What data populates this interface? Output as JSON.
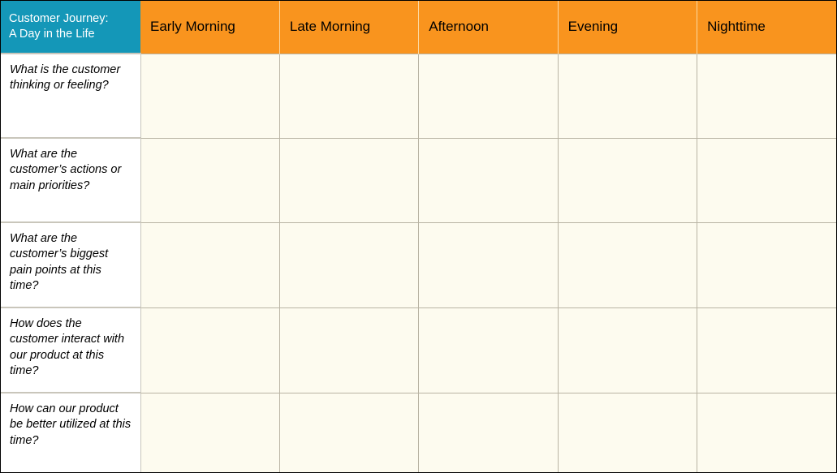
{
  "board": {
    "title_line1": "Customer Journey:",
    "title_line2": "A Day in the Life",
    "title_full": "Customer Journey: A Day in the Life",
    "colors": {
      "title_cell_background": "#1497b8",
      "title_cell_text": "#ffffff",
      "period_header_background": "#f9941e",
      "period_header_text": "#000000",
      "question_cell_background": "#ffffff",
      "entry_cell_background": "#fdfbef",
      "gridline": "#b9b4a4",
      "outer_border": "#000000"
    }
  },
  "columns": [
    {
      "id": "col-question",
      "label": "Customer Journey: A Day in the Life"
    },
    {
      "id": "col-early-morning",
      "label": "Early Morning"
    },
    {
      "id": "col-late-morning",
      "label": "Late Morning"
    },
    {
      "id": "col-afternoon",
      "label": "Afternoon"
    },
    {
      "id": "col-evening",
      "label": "Evening"
    },
    {
      "id": "col-nighttime",
      "label": "Nighttime"
    }
  ],
  "rows": [
    {
      "id": "row-thinking-feeling",
      "question": "What is the customer thinking or feeling?",
      "entries": [
        "",
        "",
        "",
        "",
        ""
      ]
    },
    {
      "id": "row-actions-priorities",
      "question": "What are the customer’s actions or main priorities?",
      "entries": [
        "",
        "",
        "",
        "",
        ""
      ]
    },
    {
      "id": "row-pain-points",
      "question": "What are the customer’s biggest pain points at this time?",
      "entries": [
        "",
        "",
        "",
        "",
        ""
      ]
    },
    {
      "id": "row-product-interaction",
      "question": "How does the customer interact with our product at this time?",
      "entries": [
        "",
        "",
        "",
        "",
        ""
      ]
    },
    {
      "id": "row-product-improvement",
      "question": "How can our product be better utilized at this time?",
      "entries": [
        "",
        "",
        "",
        "",
        ""
      ]
    }
  ]
}
